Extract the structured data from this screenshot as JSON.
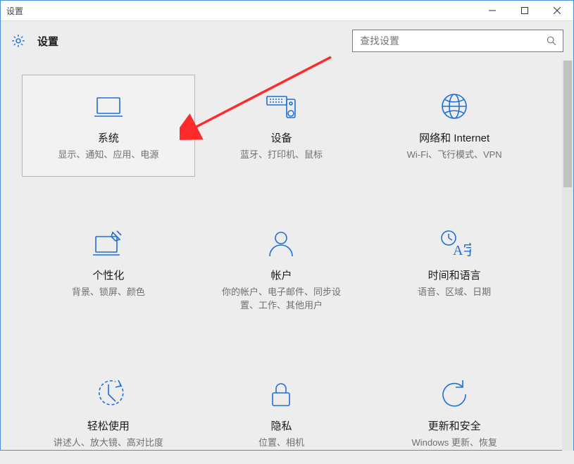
{
  "window": {
    "title": "设置"
  },
  "header": {
    "app_title": "设置"
  },
  "search": {
    "placeholder": "查找设置"
  },
  "tiles": [
    {
      "title": "系统",
      "desc": "显示、通知、应用、电源"
    },
    {
      "title": "设备",
      "desc": "蓝牙、打印机、鼠标"
    },
    {
      "title": "网络和 Internet",
      "desc": "Wi-Fi、飞行模式、VPN"
    },
    {
      "title": "个性化",
      "desc": "背景、锁屏、颜色"
    },
    {
      "title": "帐户",
      "desc": "你的帐户、电子邮件、同步设置、工作、其他用户"
    },
    {
      "title": "时间和语言",
      "desc": "语音、区域、日期"
    },
    {
      "title": "轻松使用",
      "desc": "讲述人、放大镜、高对比度"
    },
    {
      "title": "隐私",
      "desc": "位置、相机"
    },
    {
      "title": "更新和安全",
      "desc": "Windows 更新、恢复"
    }
  ],
  "accent_color": "#1E6FD9"
}
